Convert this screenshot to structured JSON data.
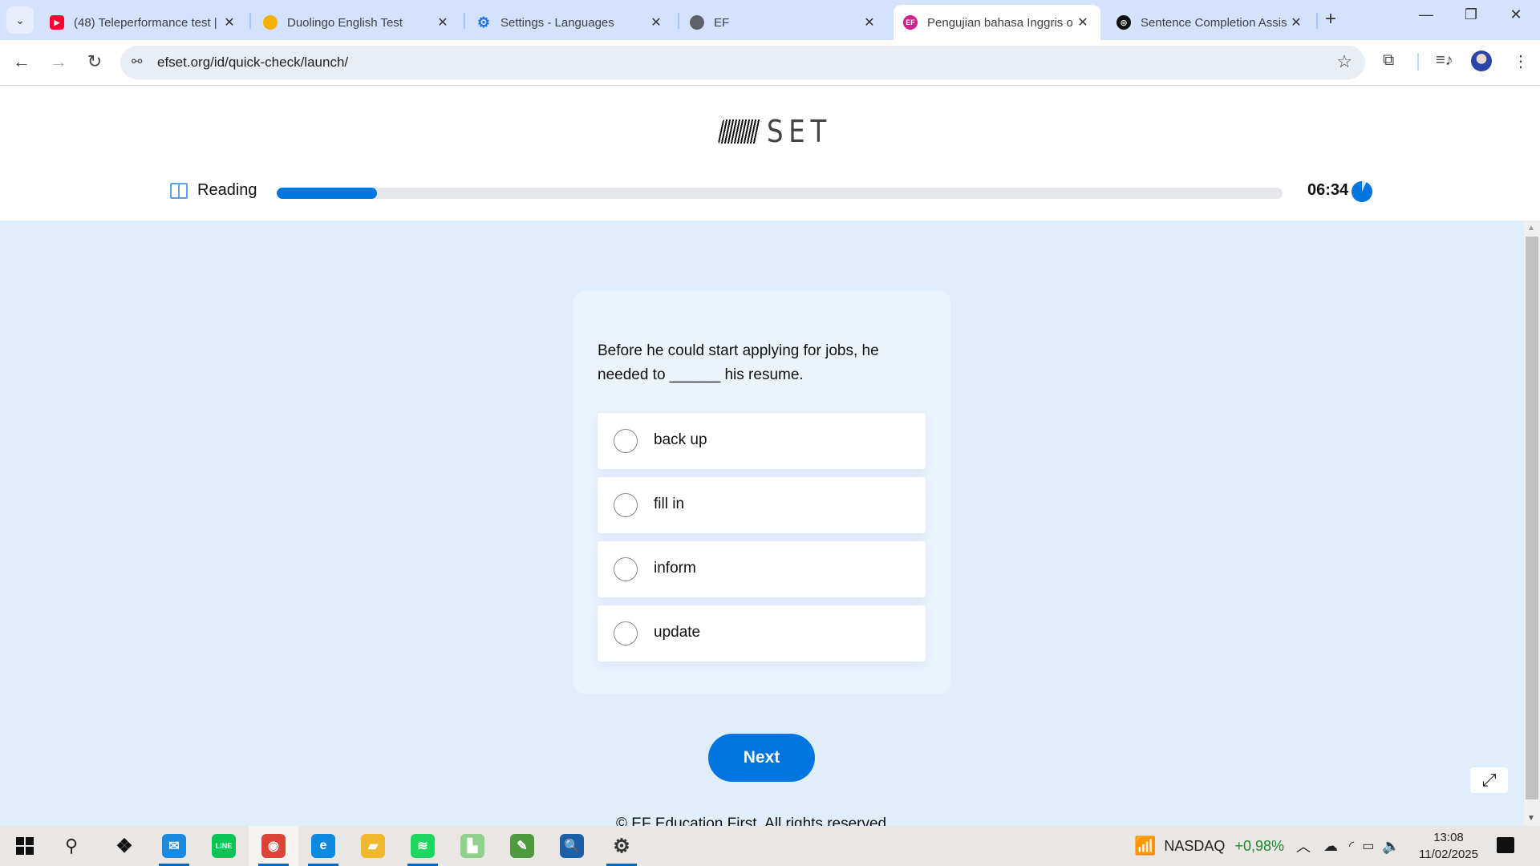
{
  "browser": {
    "tabs": [
      {
        "title": "(48) Teleperformance test |",
        "favicon": "youtube-icon",
        "color": "#ff0033",
        "active": false
      },
      {
        "title": "Duolingo English Test",
        "favicon": "duolingo-icon",
        "color": "#f5b100",
        "active": false
      },
      {
        "title": "Settings - Languages",
        "favicon": "gear-icon",
        "color": "#1a73e8",
        "active": false
      },
      {
        "title": "EF",
        "favicon": "globe-icon",
        "color": "#5f6368",
        "active": false
      },
      {
        "title": "Pengujian bahasa Inggris o",
        "favicon": "ef-icon",
        "color": "#d01e8c",
        "active": true
      },
      {
        "title": "Sentence Completion Assis",
        "favicon": "openai-icon",
        "color": "#111111",
        "active": false
      }
    ],
    "new_tab": "+",
    "url": "efset.org/id/quick-check/launch/"
  },
  "page": {
    "logo_text": "SET",
    "section_label": "Reading",
    "progress_percent": 10,
    "timer": "06:34",
    "timer_remaining_fraction": 0.93,
    "question": "Before he could start applying for jobs, he needed to ______ his resume.",
    "options": [
      "back up",
      "fill in",
      "inform",
      "update"
    ],
    "next_label": "Next",
    "footer": "© EF Education First. All rights reserved."
  },
  "taskbar": {
    "apps": [
      {
        "name": "dropbox",
        "glyph": "❖",
        "color": "#111",
        "active": false,
        "running": false
      },
      {
        "name": "mail",
        "glyph": "✉",
        "color": "#1a8ae0",
        "active": false,
        "running": true
      },
      {
        "name": "line",
        "glyph": "LINE",
        "color": "#06c755",
        "active": false,
        "running": false
      },
      {
        "name": "chrome",
        "glyph": "◉",
        "color": "#db4437",
        "active": true,
        "running": true
      },
      {
        "name": "edge",
        "glyph": "e",
        "color": "#0c8ae0",
        "active": false,
        "running": true
      },
      {
        "name": "file-explorer",
        "glyph": "▰",
        "color": "#f2b82d",
        "active": false,
        "running": false
      },
      {
        "name": "spotify",
        "glyph": "≋",
        "color": "#1ed760",
        "active": false,
        "running": true
      },
      {
        "name": "app-chart",
        "glyph": "▙",
        "color": "#8fd08a",
        "active": false,
        "running": false
      },
      {
        "name": "coreldraw",
        "glyph": "✎",
        "color": "#4e9a3c",
        "active": false,
        "running": false
      },
      {
        "name": "magnifier-globe",
        "glyph": "🔍",
        "color": "#1b5fa8",
        "active": false,
        "running": false
      },
      {
        "name": "settings",
        "glyph": "⚙",
        "color": "#333",
        "active": false,
        "running": true
      }
    ],
    "stock": {
      "name": "NASDAQ",
      "change": "+0,98%",
      "change_color": "#1b8a2e"
    },
    "time": "13:08",
    "date": "11/02/2025"
  }
}
